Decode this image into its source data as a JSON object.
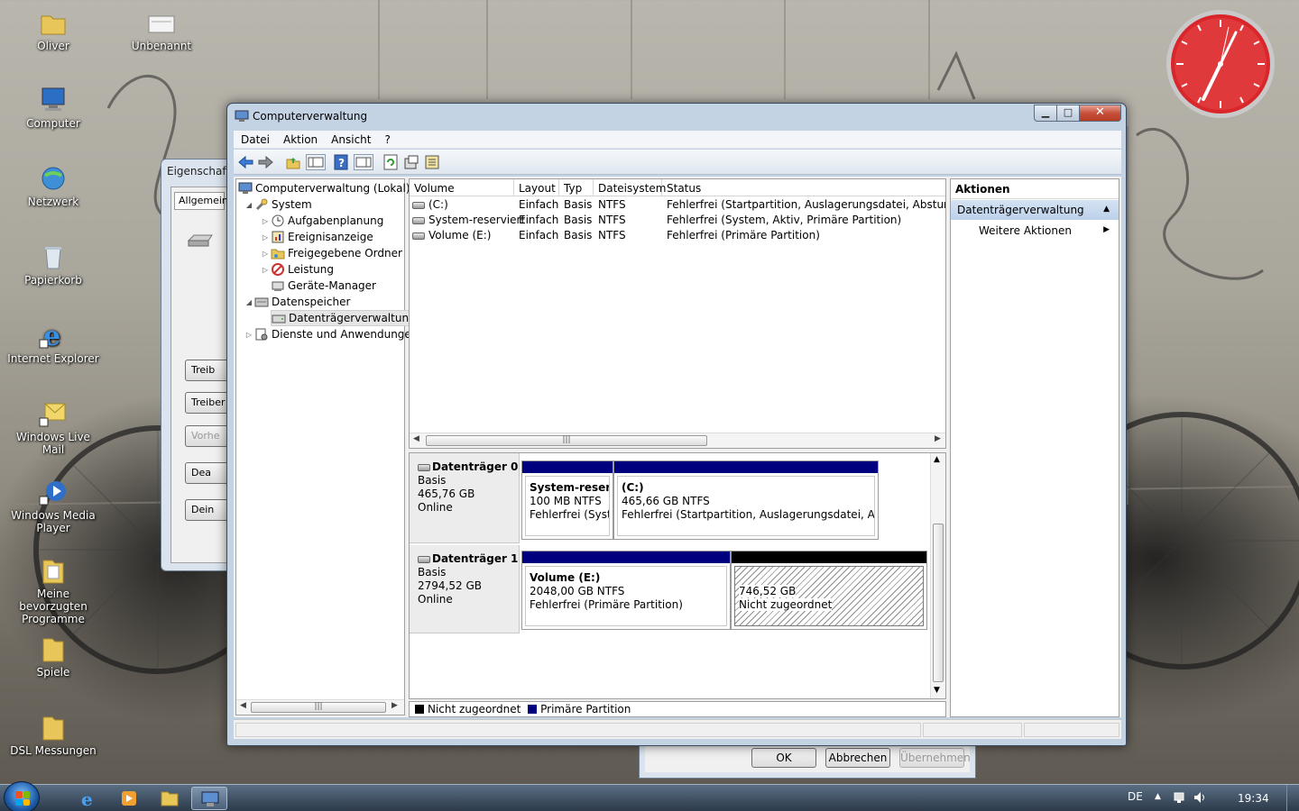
{
  "desktop": {
    "icons": [
      {
        "label": "Oliver"
      },
      {
        "label": "Unbenannt"
      },
      {
        "label": "Computer"
      },
      {
        "label": "Netzwerk"
      },
      {
        "label": "Papierkorb"
      },
      {
        "label": "Internet Explorer"
      },
      {
        "label": "Windows Live Mail"
      },
      {
        "label": "Windows Media Player"
      },
      {
        "label": "Meine bevorzugten Programme"
      },
      {
        "label": "Spiele"
      },
      {
        "label": "DSL Messungen"
      }
    ],
    "clock_time": "19:34"
  },
  "background_dialog": {
    "title": "Eigenschaften",
    "tab": "Allgemein",
    "buttons": [
      "Treib",
      "Treiber a",
      "Vorhe",
      "Dea",
      "Dein"
    ],
    "ok": "OK",
    "cancel": "Abbrechen",
    "apply": "Übernehmen"
  },
  "window": {
    "title": "Computerverwaltung",
    "menu": [
      "Datei",
      "Aktion",
      "Ansicht",
      "?"
    ],
    "tree": [
      {
        "label": "Computerverwaltung (Lokal)"
      },
      {
        "label": "System"
      },
      {
        "label": "Aufgabenplanung"
      },
      {
        "label": "Ereignisanzeige"
      },
      {
        "label": "Freigegebene Ordner"
      },
      {
        "label": "Leistung"
      },
      {
        "label": "Geräte-Manager"
      },
      {
        "label": "Datenspeicher"
      },
      {
        "label": "Datenträgerverwaltung"
      },
      {
        "label": "Dienste und Anwendungen"
      }
    ],
    "volume_list": {
      "columns": [
        "Volume",
        "Layout",
        "Typ",
        "Dateisystem",
        "Status"
      ],
      "rows": [
        [
          "(C:)",
          "Einfach",
          "Basis",
          "NTFS",
          "Fehlerfrei (Startpartition, Auslagerungsdatei, Absturzabbild"
        ],
        [
          "System-reserviert",
          "Einfach",
          "Basis",
          "NTFS",
          "Fehlerfrei (System, Aktiv, Primäre Partition)"
        ],
        [
          "Volume (E:)",
          "Einfach",
          "Basis",
          "NTFS",
          "Fehlerfrei (Primäre Partition)"
        ]
      ]
    },
    "disks": [
      {
        "name": "Datenträger 0",
        "type": "Basis",
        "size": "465,76 GB",
        "state": "Online",
        "partitions": [
          {
            "name": "System-reservi",
            "size": "100 MB NTFS",
            "status": "Fehlerfrei (Syster"
          },
          {
            "name": "(C:)",
            "size": "465,66 GB NTFS",
            "status": "Fehlerfrei (Startpartition, Auslagerungsdatei, Absturzab"
          }
        ]
      },
      {
        "name": "Datenträger 1",
        "type": "Basis",
        "size": "2794,52 GB",
        "state": "Online",
        "partitions": [
          {
            "name": "Volume  (E:)",
            "size": "2048,00 GB NTFS",
            "status": "Fehlerfrei (Primäre Partition)"
          },
          {
            "name": "",
            "size": "746,52 GB",
            "status": "Nicht zugeordnet"
          }
        ]
      }
    ],
    "legend": [
      {
        "label": "Nicht zugeordnet",
        "color": "#000000"
      },
      {
        "label": "Primäre Partition",
        "color": "#00007f"
      }
    ],
    "actions": {
      "header": "Aktionen",
      "section": "Datenträgerverwaltung",
      "item": "Weitere Aktionen"
    }
  },
  "taskbar": {
    "language": "DE",
    "time": "19:34"
  },
  "colors": {
    "primary_partition": "#00007f",
    "unallocated": "#000000",
    "selection": "#bcd1ea",
    "clock_face": "#d8262b"
  }
}
